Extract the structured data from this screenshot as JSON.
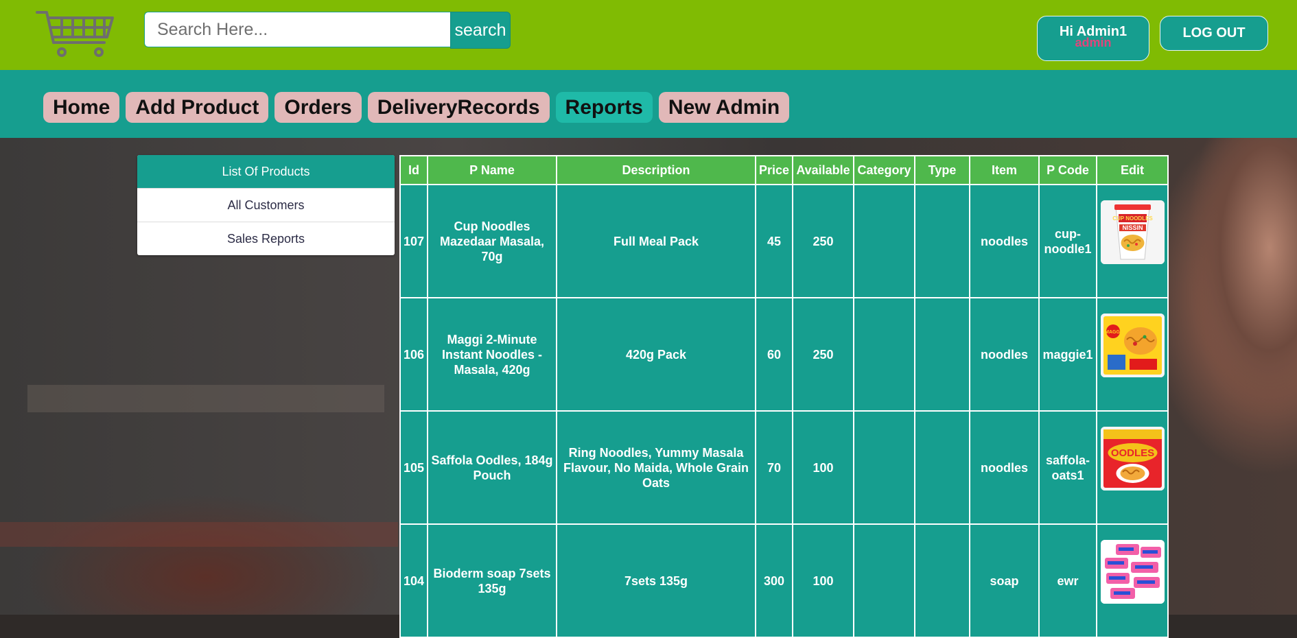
{
  "header": {
    "search": {
      "placeholder": "Search Here...",
      "value": "",
      "button_label": "search"
    },
    "user": {
      "greeting": "Hi Admin1",
      "role": "admin"
    },
    "logout_label": "LOG OUT"
  },
  "nav": {
    "items": [
      {
        "label": "Home"
      },
      {
        "label": "Add Product"
      },
      {
        "label": "Orders"
      },
      {
        "label": "DeliveryRecords"
      },
      {
        "label": "Reports"
      },
      {
        "label": "New Admin"
      }
    ],
    "active": "Reports"
  },
  "sidebar": {
    "items": [
      {
        "label": "List Of Products"
      },
      {
        "label": "All Customers"
      },
      {
        "label": "Sales Reports"
      }
    ],
    "active": "List Of Products"
  },
  "table": {
    "headers": {
      "id": "Id",
      "pname": "P Name",
      "description": "Description",
      "price": "Price",
      "available": "Available",
      "category": "Category",
      "type": "Type",
      "item": "Item",
      "pcode": "P Code",
      "edit": "Edit"
    },
    "rows": [
      {
        "id": "107",
        "pname": "Cup Noodles Mazedaar Masala, 70g",
        "description": "Full Meal Pack",
        "price": "45",
        "available": "250",
        "category": "",
        "type": "",
        "item": "noodles",
        "pcode": "cup-noodle1",
        "image_icon": "cup-noodles-image-icon"
      },
      {
        "id": "106",
        "pname": "Maggi 2-Minute Instant Noodles - Masala, 420g",
        "description": "420g Pack",
        "price": "60",
        "available": "250",
        "category": "",
        "type": "",
        "item": "noodles",
        "pcode": "maggie1",
        "image_icon": "maggi-pack-image-icon"
      },
      {
        "id": "105",
        "pname": "Saffola Oodles, 184g Pouch",
        "description": "Ring Noodles, Yummy Masala Flavour, No Maida, Whole Grain Oats",
        "price": "70",
        "available": "100",
        "category": "",
        "type": "",
        "item": "noodles",
        "pcode": "saffola-oats1",
        "image_icon": "oodles-pouch-image-icon"
      },
      {
        "id": "104",
        "pname": "Bioderm soap 7sets 135g",
        "description": "7sets 135g",
        "price": "300",
        "available": "100",
        "category": "",
        "type": "",
        "item": "soap",
        "pcode": "ewr",
        "image_icon": "bioderm-soap-image-icon"
      }
    ]
  },
  "colors": {
    "topbar": "#80bb03",
    "teal": "#169e8f",
    "nav_pill": "#e1b8b8",
    "nav_pill_active": "#1fbaa8",
    "table_header": "#4fb84c",
    "role_text": "#e0457b"
  }
}
